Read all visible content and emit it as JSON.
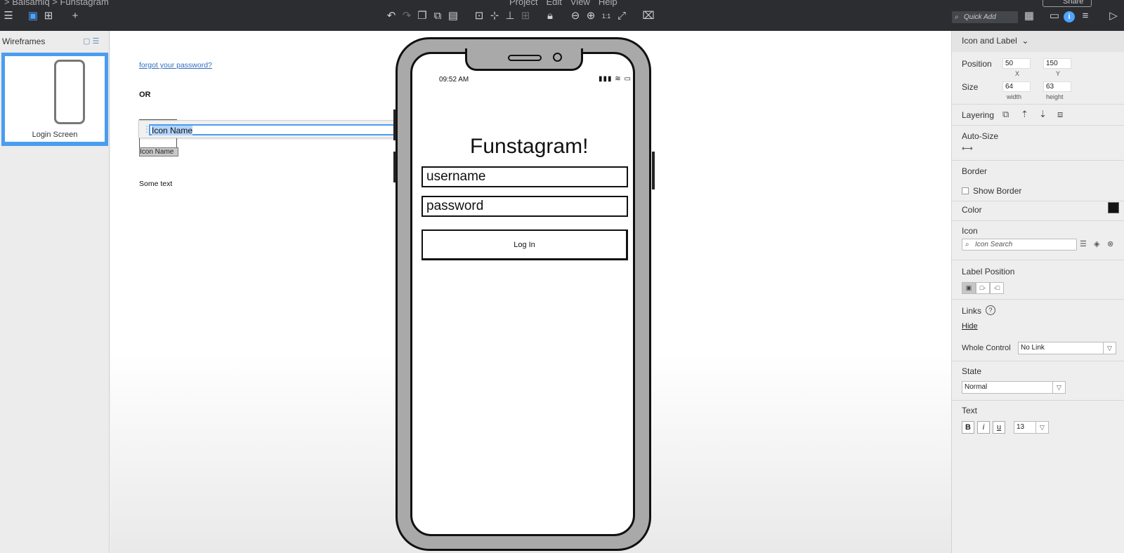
{
  "topbar": {
    "breadcrumb": "> Balsamiq > Funstagram",
    "menus": [
      "Project",
      "Edit",
      "View",
      "Help"
    ],
    "quick_add_placeholder": "Quick Add",
    "share_label": "Share",
    "info_label": "i"
  },
  "left_panel": {
    "title": "Wireframes",
    "thumbnail_label": "Login Screen"
  },
  "canvas": {
    "forgot_link": "forgot your password?",
    "or_label": "OR",
    "some_text": "Some text",
    "icon_label": "Icon Name",
    "edit_value": "Icon Name",
    "edit_count": "9"
  },
  "phone": {
    "time": "09:52 AM",
    "status_icons": "▮▮▮ ≋ ▭",
    "app_title": "Funstagram!",
    "username_placeholder": "username",
    "password_placeholder": "password",
    "login_label": "Log In"
  },
  "inspector": {
    "header": "Icon and Label",
    "position_label": "Position",
    "x_value": "50",
    "y_value": "150",
    "x_caption": "X",
    "y_caption": "Y",
    "size_label": "Size",
    "width_value": "64",
    "height_value": "63",
    "width_caption": "width",
    "height_caption": "height",
    "layering_label": "Layering",
    "autosize_label": "Auto-Size",
    "border_label": "Border",
    "show_border_label": "Show Border",
    "color_label": "Color",
    "color_value": "#111111",
    "icon_label": "Icon",
    "icon_search_placeholder": "Icon Search",
    "label_position_label": "Label Position",
    "links_label": "Links",
    "hide_link": "Hide",
    "whole_control_label": "Whole Control",
    "whole_control_value": "No Link",
    "state_label": "State",
    "state_value": "Normal",
    "text_label": "Text",
    "bold": "B",
    "italic": "i",
    "underline": "u",
    "font_size": "13"
  }
}
